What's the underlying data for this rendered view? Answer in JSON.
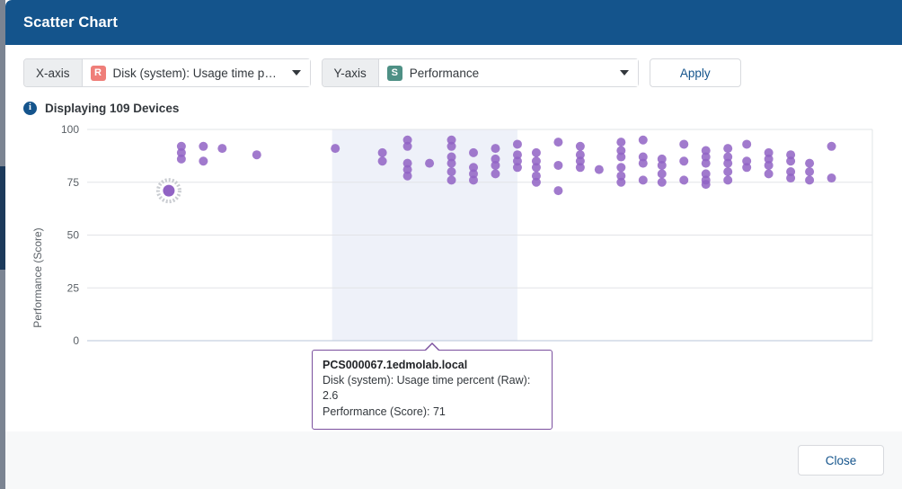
{
  "window": {
    "title": "Scatter Chart"
  },
  "toolbar": {
    "x_axis_label": "X-axis",
    "x_axis_badge": "R",
    "x_axis_value": "Disk (system): Usage time percent",
    "y_axis_label": "Y-axis",
    "y_axis_badge": "S",
    "y_axis_value": "Performance",
    "apply_label": "Apply"
  },
  "info": {
    "icon": "info-icon",
    "text": "Displaying 109 Devices"
  },
  "tooltip": {
    "title": "PCS000067.1edmolab.local",
    "line1": "Disk (system): Usage time percent (Raw): 2.6",
    "line2": "Performance (Score): 71"
  },
  "footer": {
    "close_label": "Close"
  },
  "colors": {
    "header_bg": "#14548c",
    "point": "#9163c4",
    "tooltip_border": "#7a4f9e",
    "band": "#eef1f9",
    "badge_r": "#ef7e79",
    "badge_s": "#4e9085",
    "link": "#14548c"
  },
  "chart_data": {
    "type": "scatter",
    "title": "",
    "xlabel": "Disk (system): Usage time percent (Raw)",
    "ylabel": "Performance (Score)",
    "xlim": [
      0,
      25
    ],
    "ylim": [
      0,
      100
    ],
    "yticks": [
      0,
      25,
      50,
      75,
      100
    ],
    "ytick_labels": [
      "0",
      "25",
      "50",
      "75",
      "100"
    ],
    "xticks": [],
    "xtick_labels": [],
    "grid": "horizontal",
    "legend": "none",
    "point_color": "#9163c4",
    "point_radius": 5,
    "highlight_band": {
      "x_start": 7.8,
      "x_end": 13.7,
      "color": "#eef1f9"
    },
    "highlighted_point": {
      "x": 2.6,
      "y": 71,
      "label": "PCS000067.1edmolab.local"
    },
    "series": [
      {
        "name": "Devices",
        "points": [
          [
            3.0,
            92
          ],
          [
            3.0,
            89
          ],
          [
            3.0,
            86
          ],
          [
            3.7,
            92
          ],
          [
            3.7,
            85
          ],
          [
            4.3,
            91
          ],
          [
            5.4,
            88
          ],
          [
            7.9,
            91
          ],
          [
            9.4,
            89
          ],
          [
            9.4,
            85
          ],
          [
            10.2,
            95
          ],
          [
            10.2,
            92
          ],
          [
            10.2,
            84
          ],
          [
            10.2,
            81
          ],
          [
            10.2,
            78
          ],
          [
            10.9,
            84
          ],
          [
            11.6,
            95
          ],
          [
            11.6,
            92
          ],
          [
            11.6,
            87
          ],
          [
            11.6,
            84
          ],
          [
            11.6,
            80
          ],
          [
            11.6,
            76
          ],
          [
            12.3,
            89
          ],
          [
            12.3,
            82
          ],
          [
            12.3,
            79
          ],
          [
            12.3,
            76
          ],
          [
            13.0,
            91
          ],
          [
            13.0,
            86
          ],
          [
            13.0,
            83
          ],
          [
            13.0,
            79
          ],
          [
            13.7,
            93
          ],
          [
            13.7,
            88
          ],
          [
            13.7,
            85
          ],
          [
            13.7,
            82
          ],
          [
            14.3,
            89
          ],
          [
            14.3,
            85
          ],
          [
            14.3,
            82
          ],
          [
            14.3,
            78
          ],
          [
            14.3,
            75
          ],
          [
            15.0,
            94
          ],
          [
            15.0,
            83
          ],
          [
            15.0,
            71
          ],
          [
            15.7,
            92
          ],
          [
            15.7,
            88
          ],
          [
            15.7,
            85
          ],
          [
            15.7,
            82
          ],
          [
            16.3,
            81
          ],
          [
            17.0,
            94
          ],
          [
            17.0,
            90
          ],
          [
            17.0,
            87
          ],
          [
            17.0,
            82
          ],
          [
            17.0,
            78
          ],
          [
            17.0,
            75
          ],
          [
            17.7,
            95
          ],
          [
            17.7,
            87
          ],
          [
            17.7,
            84
          ],
          [
            17.7,
            76
          ],
          [
            18.3,
            86
          ],
          [
            18.3,
            83
          ],
          [
            18.3,
            79
          ],
          [
            18.3,
            75
          ],
          [
            19.0,
            93
          ],
          [
            19.0,
            85
          ],
          [
            19.0,
            76
          ],
          [
            19.7,
            90
          ],
          [
            19.7,
            87
          ],
          [
            19.7,
            84
          ],
          [
            19.7,
            79
          ],
          [
            19.7,
            76
          ],
          [
            19.7,
            74
          ],
          [
            20.4,
            91
          ],
          [
            20.4,
            87
          ],
          [
            20.4,
            84
          ],
          [
            20.4,
            80
          ],
          [
            20.4,
            76
          ],
          [
            21.0,
            93
          ],
          [
            21.0,
            85
          ],
          [
            21.0,
            82
          ],
          [
            21.7,
            89
          ],
          [
            21.7,
            86
          ],
          [
            21.7,
            83
          ],
          [
            21.7,
            79
          ],
          [
            22.4,
            88
          ],
          [
            22.4,
            85
          ],
          [
            22.4,
            80
          ],
          [
            22.4,
            77
          ],
          [
            23.0,
            84
          ],
          [
            23.0,
            80
          ],
          [
            23.0,
            76
          ],
          [
            23.7,
            92
          ],
          [
            23.7,
            77
          ]
        ]
      }
    ]
  }
}
